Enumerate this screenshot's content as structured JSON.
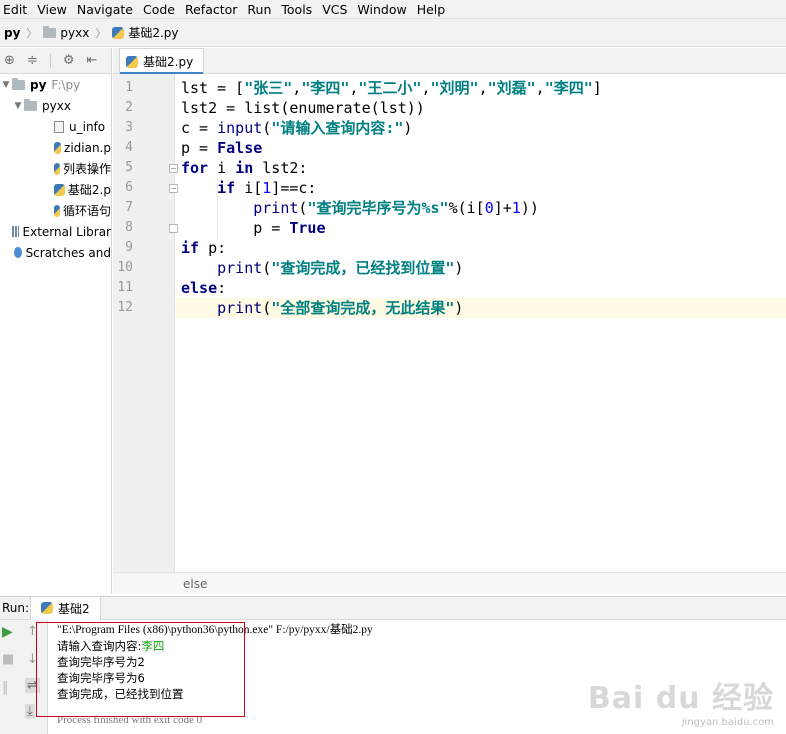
{
  "menu": [
    "Edit",
    "View",
    "Navigate",
    "Code",
    "Refactor",
    "Run",
    "Tools",
    "VCS",
    "Window",
    "Help"
  ],
  "breadcrumb": {
    "root": "py",
    "folder": "pyxx",
    "file": "基础2.py"
  },
  "project": {
    "root_name": "py",
    "root_path": "F:\\py",
    "folder": "pyxx",
    "files": [
      "u_info",
      "zidian.p",
      "列表操作",
      "基础2.p",
      "循环语句"
    ],
    "external_libraries": "External Librar",
    "scratches": "Scratches and"
  },
  "editor": {
    "tab_label": "基础2.py",
    "line_numbers": [
      "1",
      "2",
      "3",
      "4",
      "5",
      "6",
      "7",
      "8",
      "9",
      "10",
      "11",
      "12"
    ],
    "lines": [
      "lst = [\"张三\",\"李四\",\"王二小\",\"刘明\",\"刘磊\",\"李四\"]",
      "lst2 = list(enumerate(lst))",
      "c = input(\"请输入查询内容:\")",
      "p = False",
      "for i in lst2:",
      "    if i[1]==c:",
      "        print(\"查询完毕序号为%s\"%(i[0]+1))",
      "        p = True",
      "if p:",
      "    print(\"查询完成，已经找到位置\")",
      "else:",
      "    print(\"全部查询完成，无此结果\")"
    ],
    "breadcrumb_status": "else"
  },
  "run": {
    "label": "Run:",
    "tab_label": "基础2",
    "command": "\"E:\\Program Files (x86)\\python36\\python.exe\" F:/py/pyxx/基础2.py",
    "prompt": "请输入查询内容:",
    "input_value": "李四",
    "output_lines": [
      "查询完毕序号为2",
      "查询完毕序号为6",
      "查询完成，已经找到位置"
    ],
    "exit_line": "Process finished with exit code 0"
  },
  "watermark": {
    "brand": "Bai du 经验",
    "url": "jingyan.baidu.com"
  },
  "colors": {
    "keyword": "#000080",
    "string": "#008080",
    "number": "#0000ff",
    "highlight": "#d0021b",
    "input": "#13a10e"
  }
}
